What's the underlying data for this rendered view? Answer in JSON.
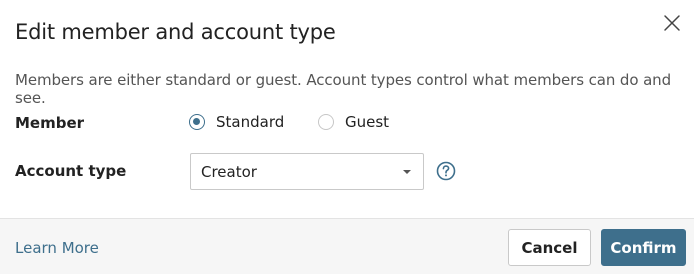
{
  "dialog": {
    "title": "Edit member and account type",
    "description": "Members are either standard or guest. Account types control what members can do and see.",
    "close_icon": "close-icon"
  },
  "member": {
    "label": "Member",
    "options": [
      {
        "label": "Standard",
        "checked": true
      },
      {
        "label": "Guest",
        "checked": false
      }
    ]
  },
  "account_type": {
    "label": "Account type",
    "selected": "Creator",
    "help_icon": "question-circle-icon"
  },
  "footer": {
    "learn_more": "Learn More",
    "cancel_label": "Cancel",
    "confirm_label": "Confirm"
  },
  "colors": {
    "accent": "#3e6f8c",
    "footer_bg": "#f6f6f6",
    "border": "#c9c9c9"
  }
}
